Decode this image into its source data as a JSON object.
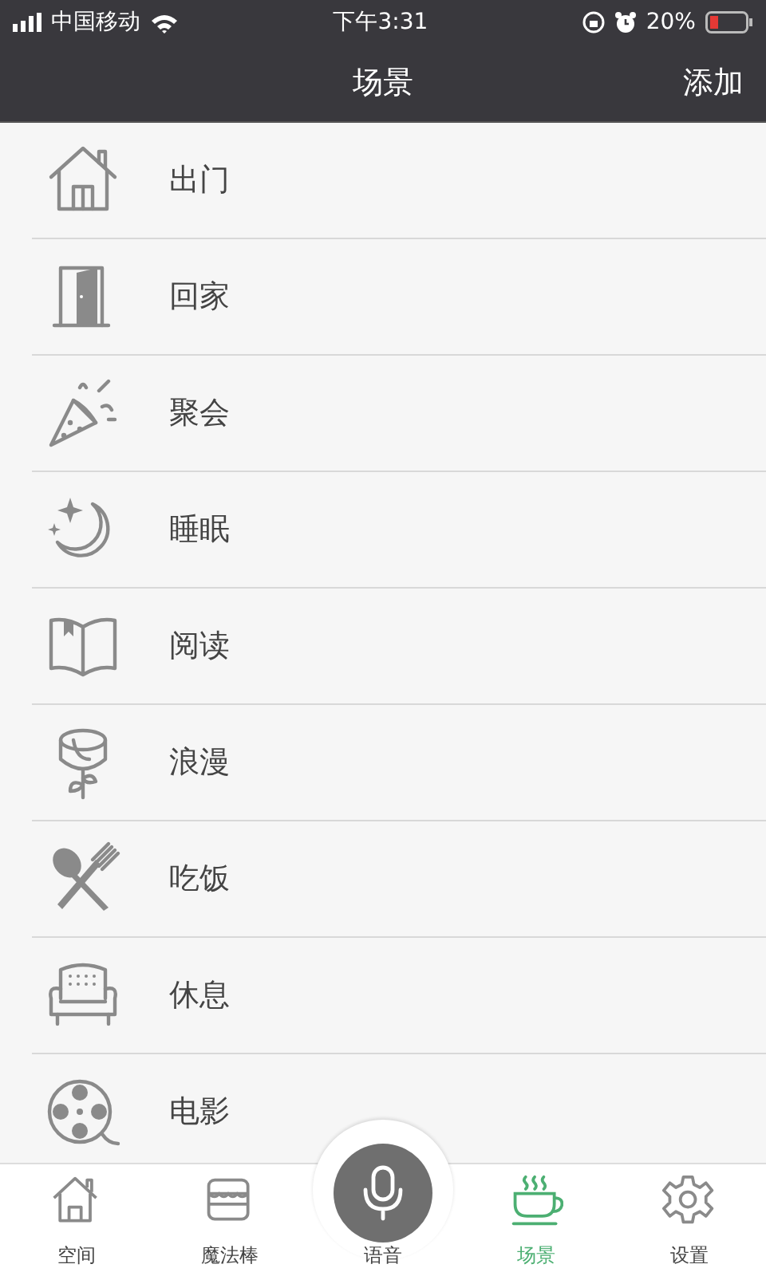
{
  "status_bar": {
    "carrier": "中国移动",
    "time": "下午3:31",
    "battery": "20%"
  },
  "nav_bar": {
    "title": "场景",
    "action": "添加"
  },
  "scenes": [
    {
      "kind": "house",
      "label": "出门"
    },
    {
      "kind": "door",
      "label": "回家"
    },
    {
      "kind": "party",
      "label": "聚会"
    },
    {
      "kind": "moon",
      "label": "睡眠"
    },
    {
      "kind": "book",
      "label": "阅读"
    },
    {
      "kind": "rose",
      "label": "浪漫"
    },
    {
      "kind": "cutlery",
      "label": "吃饭"
    },
    {
      "kind": "sofa",
      "label": "休息"
    },
    {
      "kind": "film",
      "label": "电影"
    }
  ],
  "tab_bar": [
    {
      "kind": "home",
      "label": "空间",
      "selected": false
    },
    {
      "kind": "shop",
      "label": "魔法棒",
      "selected": false
    },
    {
      "kind": "mic",
      "label": "语音",
      "selected": false
    },
    {
      "kind": "cup",
      "label": "场景",
      "selected": true
    },
    {
      "kind": "gear",
      "label": "设置",
      "selected": false
    }
  ]
}
